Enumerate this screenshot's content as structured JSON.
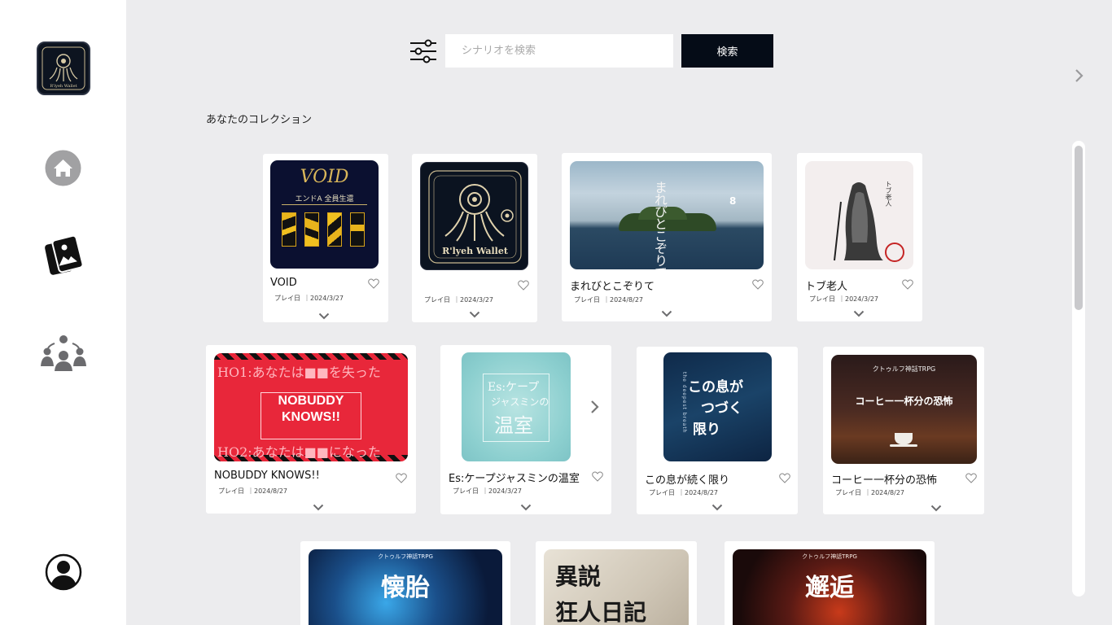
{
  "sidebar": {
    "logo_text": "R'lyeh Wallet",
    "icons": [
      "app-logo",
      "home-icon",
      "card-gallery-icon",
      "community-icon",
      "user-icon"
    ]
  },
  "search": {
    "placeholder": "シナリオを検索",
    "button_label": "検索"
  },
  "collection": {
    "title": "あなたのコレクション",
    "play_label": "プレイ日",
    "cards": [
      {
        "title": "VOID",
        "date": "｜2024/3/27",
        "thumb_text": [
          "VOID",
          "エンドA 全員生還"
        ]
      },
      {
        "title": "",
        "date": "｜2024/3/27",
        "thumb_text": [
          "R'lyeh Wallet"
        ]
      },
      {
        "title": "まれびとこぞりて",
        "date": "｜2024/8/27",
        "thumb_text": [
          "まれびとこぞりて",
          "8"
        ]
      },
      {
        "title": "トブ老人",
        "date": "｜2024/3/27",
        "thumb_text": [
          "トブ老人"
        ]
      },
      {
        "title": "NOBUDDY KNOWS!!",
        "date": "｜2024/8/27",
        "thumb_text": [
          "HO1:あなたは■■を失った",
          "NOBUDDY",
          "KNOWS!!",
          "HO2:あなたは■■になった"
        ]
      },
      {
        "title": "Es:ケープジャスミンの温室",
        "date": "｜2024/3/27",
        "thumb_text": [
          "Es:ケープ",
          "ジャスミンの",
          "温室"
        ]
      },
      {
        "title": "この息が続く限り",
        "date": "｜2024/8/27",
        "thumb_text": [
          "この息が",
          "つづく",
          "限り",
          "the deepest breath"
        ]
      },
      {
        "title": "コーヒー一杯分の恐怖",
        "date": "｜2024/8/27",
        "thumb_text": [
          "クトゥルフ神話TRPG",
          "コーヒー一杯分の恐怖"
        ]
      },
      {
        "title": "",
        "date": "",
        "thumb_text": [
          "クトゥルフ神話TRPG",
          "懐胎"
        ]
      },
      {
        "title": "",
        "date": "",
        "thumb_text": [
          "異説",
          "狂人日記"
        ]
      },
      {
        "title": "",
        "date": "",
        "thumb_text": [
          "クトゥルフ神話TRPG",
          "邂逅"
        ]
      }
    ]
  },
  "colors": {
    "background": "#ececee",
    "sidebar": "#ffffff",
    "search_button": "#050c17",
    "card": "#ffffff",
    "icon_gray": "#a0a0a0"
  }
}
